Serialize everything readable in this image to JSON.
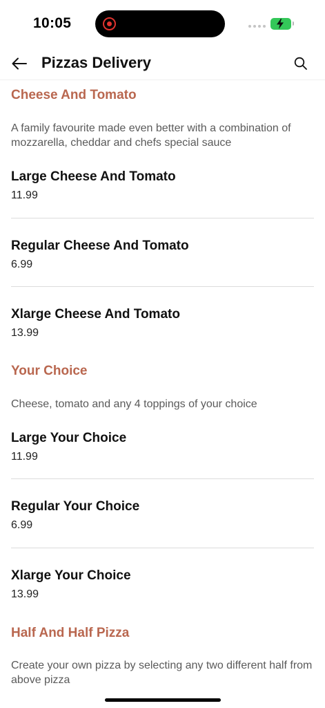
{
  "status": {
    "time": "10:05"
  },
  "header": {
    "title": "Pizzas Delivery",
    "back_icon": "arrow-left-icon",
    "search_icon": "search-icon"
  },
  "categories": [
    {
      "title": "Cheese And Tomato",
      "description": "A family favourite made even better with a combination of mozzarella, cheddar and chefs special sauce",
      "items": [
        {
          "name": "Large Cheese And Tomato",
          "price": "11.99"
        },
        {
          "name": "Regular Cheese And Tomato",
          "price": "6.99"
        },
        {
          "name": "Xlarge Cheese And Tomato",
          "price": "13.99"
        }
      ]
    },
    {
      "title": "Your Choice",
      "description": "Cheese, tomato and any 4 toppings of your choice",
      "items": [
        {
          "name": "Large Your Choice",
          "price": "11.99"
        },
        {
          "name": "Regular Your Choice",
          "price": "6.99"
        },
        {
          "name": "Xlarge Your Choice",
          "price": "13.99"
        }
      ]
    },
    {
      "title": "Half And Half Pizza",
      "description": "Create your own pizza by selecting any two different half from above pizza"
    }
  ],
  "colors": {
    "accent": "#b9674f",
    "battery": "#34c759",
    "recording": "#e0332f"
  }
}
